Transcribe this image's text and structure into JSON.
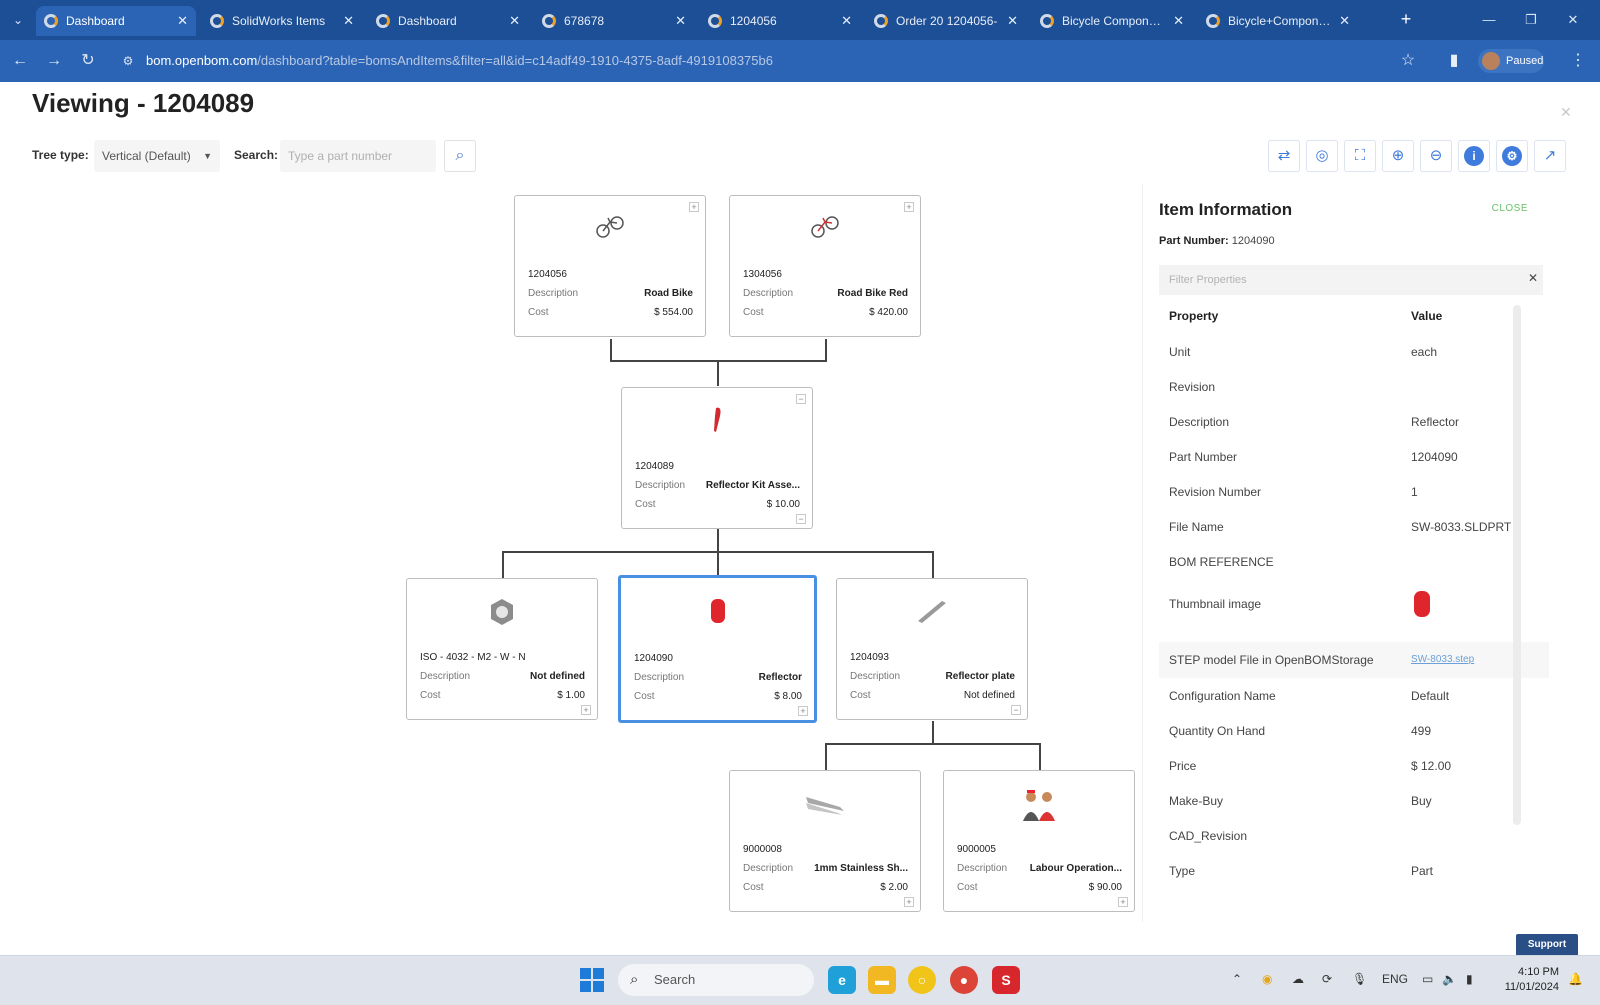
{
  "browser": {
    "tabs": [
      {
        "title": "Dashboard",
        "active": true
      },
      {
        "title": "SolidWorks Items",
        "active": false
      },
      {
        "title": "Dashboard",
        "active": false
      },
      {
        "title": "678678",
        "active": false
      },
      {
        "title": "1204056",
        "active": false
      },
      {
        "title": "Order 20 1204056-",
        "active": false
      },
      {
        "title": "Bicycle Components",
        "active": false
      },
      {
        "title": "Bicycle+Component",
        "active": false
      }
    ],
    "url_host": "bom.openbom.com",
    "url_path": "/dashboard?table=bomsAndItems&filter=all&id=c14adf49-1910-4375-8adf-4919108375b6",
    "profile_label": "Paused"
  },
  "page": {
    "title": "Viewing - 1204089",
    "tree_type_label": "Tree type:",
    "tree_type_value": "Vertical (Default)",
    "search_label": "Search:",
    "search_placeholder": "Type a part number"
  },
  "tree": {
    "nodes": [
      {
        "id": "n1",
        "part_number": "1204056",
        "description": "Road Bike",
        "cost": "$ 554.00",
        "thumb": "bike-icon"
      },
      {
        "id": "n2",
        "part_number": "1304056",
        "description": "Road Bike Red",
        "cost": "$ 420.00",
        "thumb": "bike-icon"
      },
      {
        "id": "n3",
        "part_number": "1204089",
        "description": "Reflector Kit Asse...",
        "cost": "$ 10.00",
        "thumb": "reflector-kit-icon"
      },
      {
        "id": "n4",
        "part_number": "ISO - 4032 - M2 - W - N",
        "description": "Not defined",
        "cost": "$ 1.00",
        "thumb": "nut-icon"
      },
      {
        "id": "n5",
        "part_number": "1204090",
        "description": "Reflector",
        "cost": "$ 8.00",
        "thumb": "reflector-icon"
      },
      {
        "id": "n6",
        "part_number": "1204093",
        "description": "Reflector plate",
        "cost": "Not defined",
        "thumb": "plate-icon"
      },
      {
        "id": "n7",
        "part_number": "9000008",
        "description": "1mm Stainless Sh...",
        "cost": "$ 2.00",
        "thumb": "sheet-icon"
      },
      {
        "id": "n8",
        "part_number": "9000005",
        "description": "Labour Operation...",
        "cost": "$ 90.00",
        "thumb": "labour-icon"
      }
    ],
    "description_label": "Description",
    "cost_label": "Cost"
  },
  "panel": {
    "title": "Item Information",
    "close_label": "CLOSE",
    "part_number_label": "Part Number:",
    "part_number": "1204090",
    "filter_placeholder": "Filter Properties",
    "property_header": "Property",
    "value_header": "Value",
    "properties": [
      {
        "name": "Unit",
        "value": "each"
      },
      {
        "name": "Revision",
        "value": ""
      },
      {
        "name": "Description",
        "value": "Reflector"
      },
      {
        "name": "Part Number",
        "value": "1204090"
      },
      {
        "name": "Revision Number",
        "value": "1"
      },
      {
        "name": "File Name",
        "value": "SW-8033.SLDPRT"
      },
      {
        "name": "BOM REFERENCE",
        "value": ""
      },
      {
        "name": "Thumbnail image",
        "value": ""
      },
      {
        "name": "STEP model File in OpenBOMStorage",
        "value": "SW-8033.step"
      },
      {
        "name": "Configuration Name",
        "value": "Default"
      },
      {
        "name": "Quantity On Hand",
        "value": "499"
      },
      {
        "name": "Price",
        "value": "$ 12.00"
      },
      {
        "name": "Make-Buy",
        "value": "Buy"
      },
      {
        "name": "CAD_Revision",
        "value": ""
      },
      {
        "name": "Type",
        "value": "Part"
      }
    ],
    "support_label": "Support"
  },
  "taskbar": {
    "search_label": "Search",
    "lang": "ENG",
    "time": "4:10 PM",
    "date": "11/01/2024"
  },
  "colors": {
    "browser_tabstrip": "#1c4f96",
    "browser_toolbar": "#2b64b5",
    "accent": "#3f7bdc",
    "selected_border": "#4a90e2",
    "close_green": "#6ac26a",
    "reflector_red": "#e0262d"
  }
}
